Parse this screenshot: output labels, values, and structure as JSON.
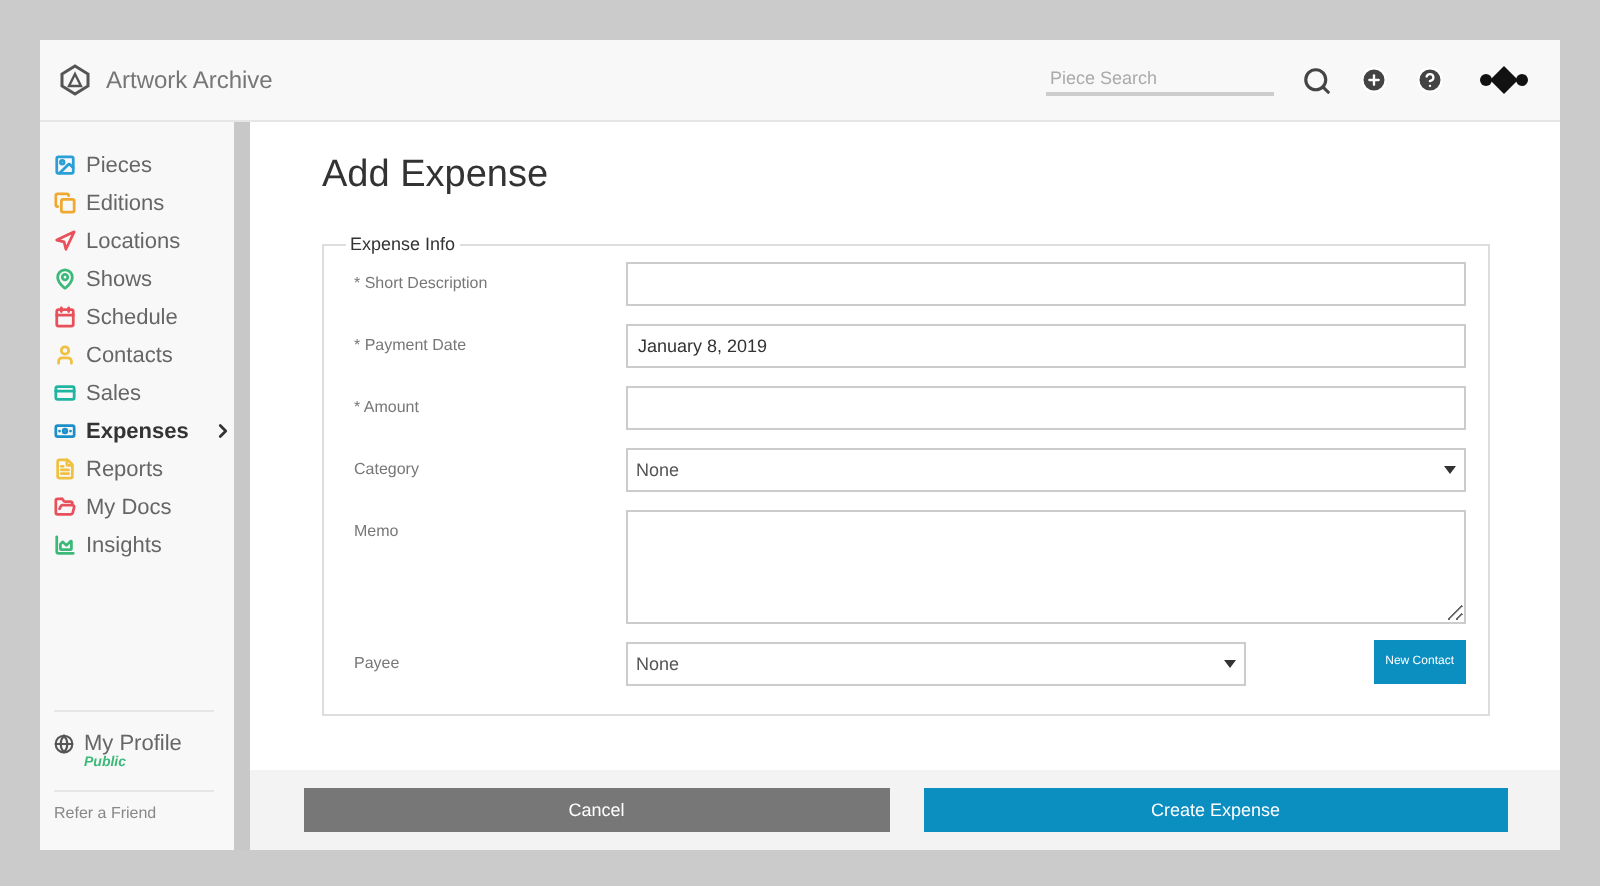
{
  "header": {
    "brand": "Artwork Archive",
    "search": {
      "placeholder": "Piece Search"
    }
  },
  "sidebar": {
    "items": [
      {
        "label": "Pieces",
        "color": "#2a9fd6",
        "selected": false
      },
      {
        "label": "Editions",
        "color": "#f0a830",
        "selected": false
      },
      {
        "label": "Locations",
        "color": "#e8505b",
        "selected": false
      },
      {
        "label": "Shows",
        "color": "#3cb878",
        "selected": false
      },
      {
        "label": "Schedule",
        "color": "#e8505b",
        "selected": false
      },
      {
        "label": "Contacts",
        "color": "#f0c040",
        "selected": false
      },
      {
        "label": "Sales",
        "color": "#1fb5a0",
        "selected": false
      },
      {
        "label": "Expenses",
        "color": "#1a8fc8",
        "selected": true
      },
      {
        "label": "Reports",
        "color": "#f0c040",
        "selected": false
      },
      {
        "label": "My Docs",
        "color": "#e8505b",
        "selected": false
      },
      {
        "label": "Insights",
        "color": "#3cb878",
        "selected": false
      }
    ],
    "profile": {
      "label": "My Profile",
      "status": "Public"
    },
    "links": [
      "Refer a Friend"
    ]
  },
  "page": {
    "title": "Add Expense",
    "legend": "Expense Info",
    "fields": [
      {
        "label": "* Short Description",
        "kind": "text"
      },
      {
        "label": "* Payment Date",
        "kind": "text",
        "value": "January 8, 2019"
      },
      {
        "label": "* Amount",
        "kind": "text"
      },
      {
        "label": "Category",
        "kind": "select",
        "value": "None"
      },
      {
        "label": "Memo",
        "kind": "textarea"
      },
      {
        "label": "Payee",
        "kind": "select",
        "value": "None",
        "button": "New Contact"
      }
    ]
  },
  "footer": {
    "cancel": "Cancel",
    "submit": "Create Expense"
  }
}
